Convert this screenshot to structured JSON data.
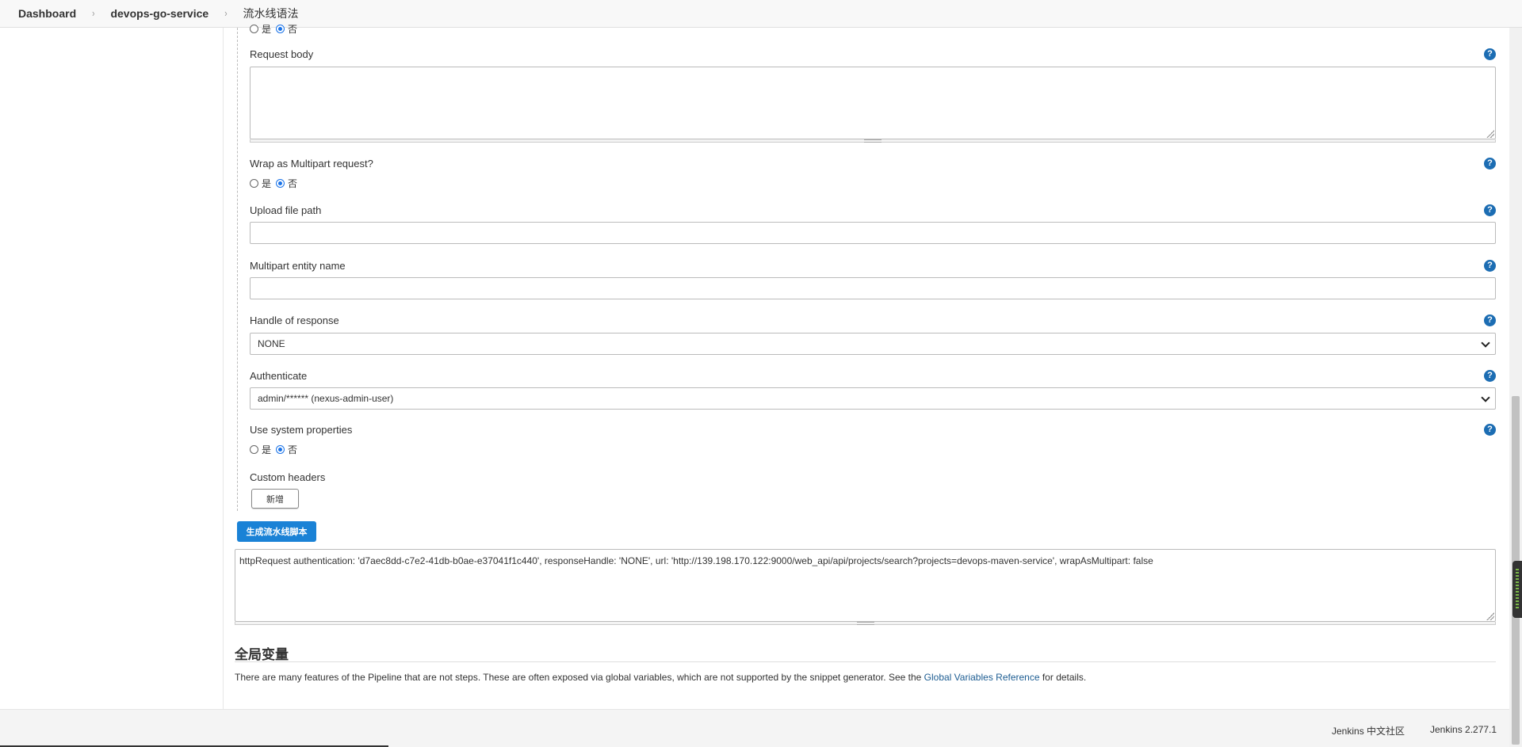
{
  "breadcrumb": {
    "items": [
      "Dashboard",
      "devops-go-service",
      "流水线语法"
    ]
  },
  "form": {
    "top_radio": {
      "yes": "是",
      "no": "否",
      "selected": "no"
    },
    "request_body": {
      "label": "Request body",
      "value": ""
    },
    "wrap_multipart": {
      "label": "Wrap as Multipart request?",
      "yes": "是",
      "no": "否",
      "selected": "no"
    },
    "upload_file_path": {
      "label": "Upload file path",
      "value": ""
    },
    "multipart_entity_name": {
      "label": "Multipart entity name",
      "value": ""
    },
    "handle_of_response": {
      "label": "Handle of response",
      "value": "NONE"
    },
    "authenticate": {
      "label": "Authenticate",
      "value": "admin/****** (nexus-admin-user)"
    },
    "use_system_properties": {
      "label": "Use system properties",
      "yes": "是",
      "no": "否",
      "selected": "no"
    },
    "custom_headers": {
      "label": "Custom headers",
      "add_label": "新增"
    }
  },
  "generate_button": "生成流水线脚本",
  "output": "httpRequest authentication: 'd7aec8dd-c7e2-41db-b0ae-e37041f1c440', responseHandle: 'NONE', url: 'http://139.198.170.122:9000/web_api/api/projects/search?projects=devops-maven-service', wrapAsMultipart: false",
  "global_vars": {
    "title": "全局变量",
    "desc_before": "There are many features of the Pipeline that are not steps. These are often exposed via global variables, which are not supported by the snippet generator. See the ",
    "link": "Global Variables Reference",
    "desc_after": " for details."
  },
  "footer": {
    "community": "Jenkins 中文社区",
    "version": "Jenkins 2.277.1"
  },
  "colors": {
    "accent": "#1a82d6",
    "help": "#1c6db3",
    "link": "#1d5d92"
  }
}
